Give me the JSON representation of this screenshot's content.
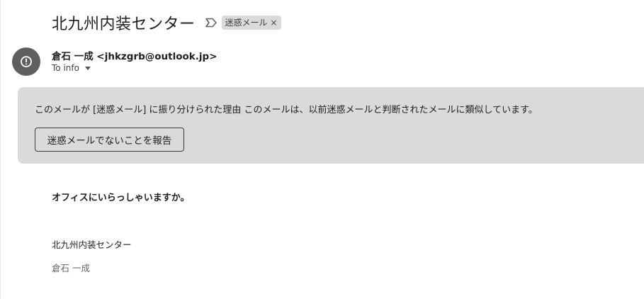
{
  "email": {
    "subject": "北九州内装センター",
    "importance_icon": "label-importance-outline-icon",
    "labels": [
      {
        "text": "迷惑メール",
        "remove": "×"
      }
    ],
    "sender": {
      "avatar_icon": "exclamation-circle-icon",
      "display": "倉石 一成 <jhkzgrb@outlook.jp>",
      "to": "To info"
    }
  },
  "spam_banner": {
    "message": "このメールが [迷惑メール] に振り分けられた理由 このメールは、以前迷惑メールと判断されたメールに類似しています。",
    "button_label": "迷惑メールでないことを報告"
  },
  "body": {
    "heading": "オフィスにいらっしゃいますか。",
    "signature_company": "北九州内装センター",
    "signature_name": "倉石 一成"
  },
  "colors": {
    "banner_bg": "#dadada",
    "chip_bg": "#dadada",
    "avatar_bg": "#5f5f5f"
  }
}
